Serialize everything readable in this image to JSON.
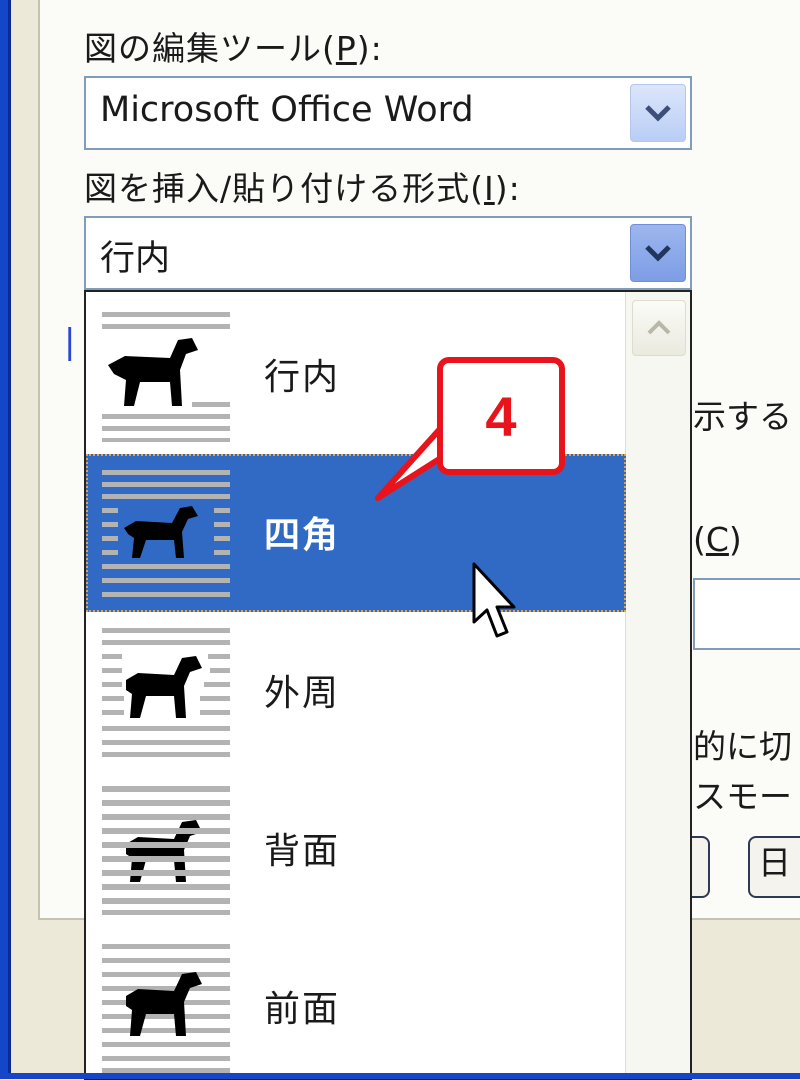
{
  "dialog": {
    "edit_tool_label": "図の編集ツール(",
    "edit_tool_key": "P",
    "edit_tool_suffix": "):",
    "edit_tool_value": "Microsoft Office Word",
    "insert_format_label": "図を挿入/貼り付ける形式(",
    "insert_format_key": "I",
    "insert_format_suffix": "):",
    "insert_format_value": "行内"
  },
  "dropdown": {
    "items": [
      {
        "label": "行内",
        "icon": "wrap-inline-icon"
      },
      {
        "label": "四角",
        "icon": "wrap-square-icon",
        "selected": true
      },
      {
        "label": "外周",
        "icon": "wrap-tight-icon"
      },
      {
        "label": "背面",
        "icon": "wrap-behind-text-icon"
      },
      {
        "label": "前面",
        "icon": "wrap-in-front-icon"
      }
    ]
  },
  "background_fragments": {
    "display_text": "示する",
    "c_label_paren": "(",
    "c_label_key": "C",
    "c_label_close": ")",
    "auto_switch": "的に切",
    "mode": "スモート",
    "btn_partial": "日"
  },
  "callout": {
    "step_number": "4"
  },
  "colors": {
    "selection": "#316ac5",
    "callout_red": "#e8131b",
    "xp_blue": "#1646c8"
  }
}
